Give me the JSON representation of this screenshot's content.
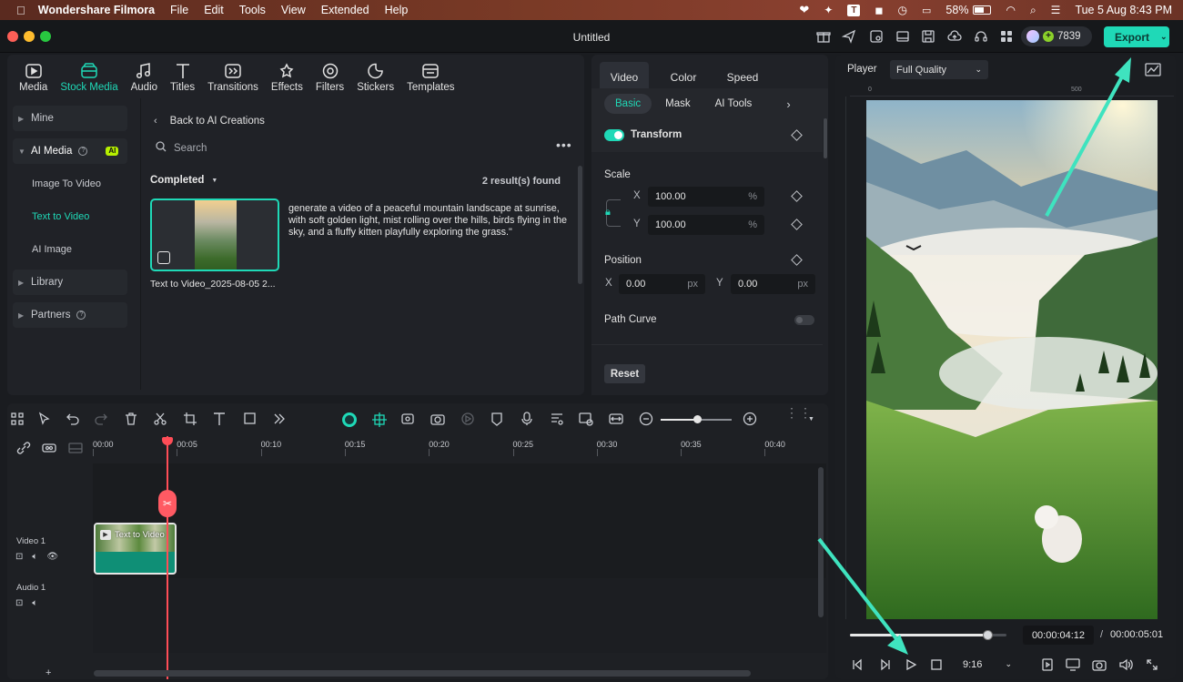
{
  "menubar": {
    "app_name": "Wondershare Filmora",
    "items": [
      "File",
      "Edit",
      "Tools",
      "View",
      "Extended",
      "Help"
    ],
    "battery": "58%",
    "datetime": "Tue 5 Aug  8:43 PM"
  },
  "window": {
    "title": "Untitled"
  },
  "header": {
    "credits": "7839",
    "export_label": "Export",
    "accent": "#1fd9b7"
  },
  "library": {
    "tabs": [
      {
        "label": "Media",
        "icon": "media-icon"
      },
      {
        "label": "Stock Media",
        "icon": "stock-media-icon"
      },
      {
        "label": "Audio",
        "icon": "audio-icon"
      },
      {
        "label": "Titles",
        "icon": "titles-icon"
      },
      {
        "label": "Transitions",
        "icon": "transitions-icon"
      },
      {
        "label": "Effects",
        "icon": "effects-icon"
      },
      {
        "label": "Filters",
        "icon": "filters-icon"
      },
      {
        "label": "Stickers",
        "icon": "stickers-icon"
      },
      {
        "label": "Templates",
        "icon": "templates-icon"
      }
    ],
    "sidebar": {
      "mine": "Mine",
      "ai_media": "AI Media",
      "ai_badge": "AI",
      "image_to_video": "Image To Video",
      "text_to_video": "Text to Video",
      "ai_image": "AI Image",
      "library": "Library",
      "partners": "Partners"
    },
    "back_label": "Back to AI Creations",
    "search_placeholder": "Search",
    "filter_label": "Completed",
    "results_count": "2 result(s) found",
    "result": {
      "prompt": "generate a video of a peaceful mountain landscape at sunrise, with soft golden light, mist rolling over the hills, birds flying in the sky, and a fluffy kitten playfully exploring the grass.\"",
      "name": "Text to Video_2025-08-05 2..."
    }
  },
  "properties": {
    "tabs": [
      "Video",
      "Color",
      "Speed"
    ],
    "subtabs": [
      "Basic",
      "Mask",
      "AI Tools"
    ],
    "transform_label": "Transform",
    "scale_label": "Scale",
    "scale_x": "100.00",
    "scale_y": "100.00",
    "percent": "%",
    "position_label": "Position",
    "pos_x": "0.00",
    "pos_y": "0.00",
    "px": "px",
    "x": "X",
    "y": "Y",
    "path_curve_label": "Path Curve",
    "reset_label": "Reset"
  },
  "player": {
    "label": "Player",
    "quality": "Full Quality",
    "ruler_start": "0",
    "ruler_mid": "500",
    "current_time": "00:00:04:12",
    "separator": "/",
    "total_time": "00:00:05:01",
    "aspect": "9:16",
    "progress_fraction": 0.88
  },
  "timeline": {
    "ticks": [
      "00:00",
      "00:05",
      "00:10",
      "00:15",
      "00:20",
      "00:25",
      "00:30",
      "00:35",
      "00:40"
    ],
    "video_track": "Video 1",
    "audio_track": "Audio 1",
    "clip_label": "Text to Video",
    "add_label": "+"
  }
}
